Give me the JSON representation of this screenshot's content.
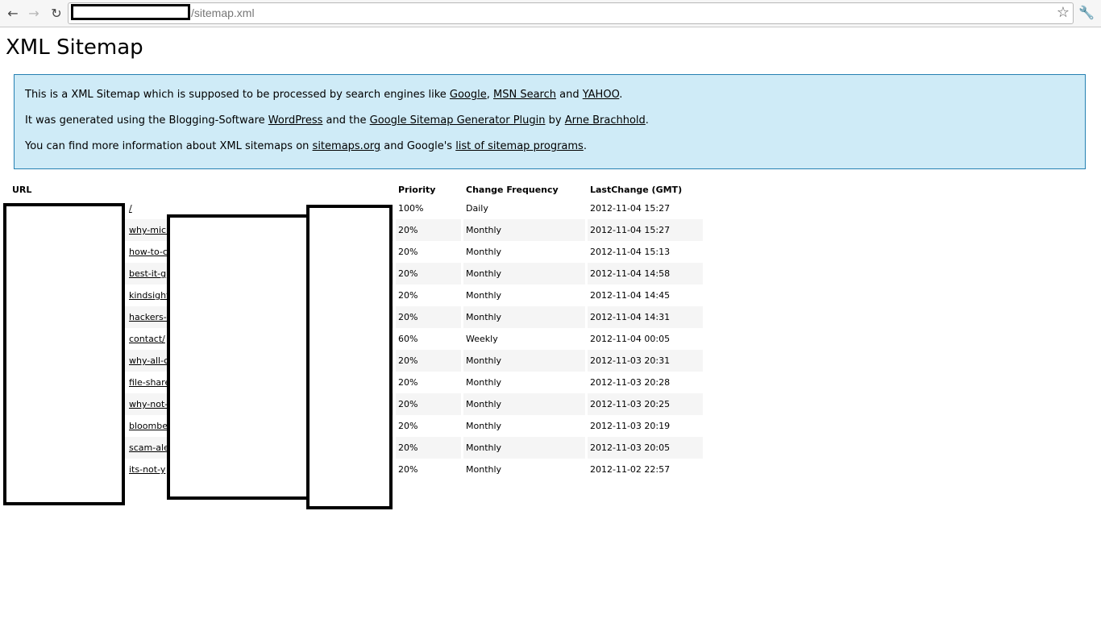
{
  "browser": {
    "url_path": "/sitemap.xml",
    "back_icon": "arrow-left",
    "forward_icon": "arrow-right",
    "reload_icon": "reload",
    "bookmark_icon": "star",
    "menu_icon": "wrench"
  },
  "page": {
    "title": "XML Sitemap",
    "intro": {
      "p1": {
        "text_before": "This is a XML Sitemap which is supposed to be processed by search engines like ",
        "link1": "Google",
        "sep1": ", ",
        "link2": "MSN Search",
        "sep2": " and ",
        "link3": "YAHOO",
        "end": "."
      },
      "p2": {
        "text_before": "It was generated using the Blogging-Software ",
        "link1": "WordPress",
        "sep1": " and the ",
        "link2": "Google Sitemap Generator Plugin",
        "sep2": " by ",
        "link3": "Arne Brachhold",
        "end": "."
      },
      "p3": {
        "text_before": "You can find more information about XML sitemaps on ",
        "link1": "sitemaps.org",
        "sep1": " and Google's ",
        "link2": "list of sitemap programs",
        "end": "."
      }
    },
    "table": {
      "headers": {
        "url": "URL",
        "priority": "Priority",
        "change_frequency": "Change Frequency",
        "last_change": "LastChange (GMT)"
      },
      "rows": [
        {
          "url": "/",
          "priority": "100%",
          "freq": "Daily",
          "last": "2012-11-04 15:27"
        },
        {
          "url": "why-micr",
          "priority": "20%",
          "freq": "Monthly",
          "last": "2012-11-04 15:27"
        },
        {
          "url": "how-to-c",
          "priority": "20%",
          "freq": "Monthly",
          "last": "2012-11-04 15:13"
        },
        {
          "url": "best-it-g",
          "priority": "20%",
          "freq": "Monthly",
          "last": "2012-11-04 14:58"
        },
        {
          "url": "kindsight",
          "priority": "20%",
          "freq": "Monthly",
          "last": "2012-11-04 14:45"
        },
        {
          "url": "hackers-c",
          "priority": "20%",
          "freq": "Monthly",
          "last": "2012-11-04 14:31"
        },
        {
          "url": "contact/",
          "priority": "60%",
          "freq": "Weekly",
          "last": "2012-11-04 00:05"
        },
        {
          "url": "why-all-c",
          "priority": "20%",
          "freq": "Monthly",
          "last": "2012-11-03 20:31"
        },
        {
          "url": "file-share",
          "priority": "20%",
          "freq": "Monthly",
          "last": "2012-11-03 20:28"
        },
        {
          "url": "why-not-",
          "priority": "20%",
          "freq": "Monthly",
          "last": "2012-11-03 20:25"
        },
        {
          "url": "bloomber",
          "priority": "20%",
          "freq": "Monthly",
          "last": "2012-11-03 20:19"
        },
        {
          "url": "scam-ale",
          "priority": "20%",
          "freq": "Monthly",
          "last": "2012-11-03 20:05"
        },
        {
          "url": "its-not-y",
          "priority": "20%",
          "freq": "Monthly",
          "last": "2012-11-02 22:57"
        }
      ]
    }
  }
}
